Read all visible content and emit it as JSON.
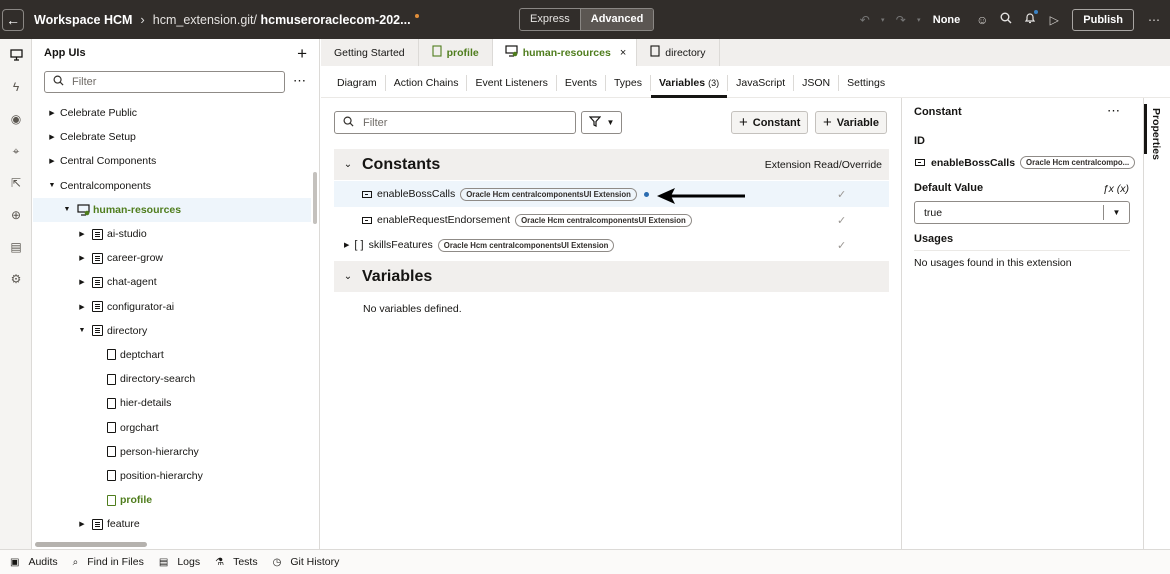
{
  "topbar": {
    "back_icon": "arrow-left-icon",
    "workspace_title": "Workspace HCM",
    "path_repo": "hcm_extension.git/",
    "path_branch": "hcmuseroraclecom-202...",
    "mode_express": "Express",
    "mode_advanced": "Advanced",
    "none_label": "None",
    "publish_label": "Publish"
  },
  "left_rail": {
    "icons": [
      "monitor-icon",
      "lightning-icon",
      "eye-icon",
      "pin-icon",
      "export-icon",
      "globe-icon",
      "file-icon",
      "settings-badge-icon"
    ]
  },
  "app_uis": {
    "title": "App UIs",
    "filter_placeholder": "Filter",
    "tree": [
      {
        "label": "Celebrate Public",
        "level": 0,
        "toggle": "collapsed",
        "icon": "none"
      },
      {
        "label": "Celebrate Setup",
        "level": 0,
        "toggle": "collapsed",
        "icon": "none"
      },
      {
        "label": "Central Components",
        "level": 0,
        "toggle": "collapsed",
        "icon": "none"
      },
      {
        "label": "Centralcomponents",
        "level": 0,
        "toggle": "expanded",
        "icon": "none"
      },
      {
        "label": "human-resources",
        "level": 1,
        "toggle": "expanded",
        "icon": "app-icon",
        "selected": true
      },
      {
        "label": "ai-studio",
        "level": 2,
        "toggle": "collapsed",
        "icon": "folder-icon"
      },
      {
        "label": "career-grow",
        "level": 2,
        "toggle": "collapsed",
        "icon": "folder-icon"
      },
      {
        "label": "chat-agent",
        "level": 2,
        "toggle": "collapsed",
        "icon": "folder-icon"
      },
      {
        "label": "configurator-ai",
        "level": 2,
        "toggle": "collapsed",
        "icon": "folder-icon"
      },
      {
        "label": "directory",
        "level": 2,
        "toggle": "expanded",
        "icon": "folder-icon"
      },
      {
        "label": "deptchart",
        "level": 3,
        "toggle": "none",
        "icon": "page-icon"
      },
      {
        "label": "directory-search",
        "level": 3,
        "toggle": "none",
        "icon": "page-icon"
      },
      {
        "label": "hier-details",
        "level": 3,
        "toggle": "none",
        "icon": "page-icon"
      },
      {
        "label": "orgchart",
        "level": 3,
        "toggle": "none",
        "icon": "page-icon"
      },
      {
        "label": "person-hierarchy",
        "level": 3,
        "toggle": "none",
        "icon": "page-icon"
      },
      {
        "label": "position-hierarchy",
        "level": 3,
        "toggle": "none",
        "icon": "page-icon"
      },
      {
        "label": "profile",
        "level": 3,
        "toggle": "none",
        "icon": "page-icon",
        "green": true
      },
      {
        "label": "feature",
        "level": 2,
        "toggle": "collapsed",
        "icon": "folder-icon"
      }
    ]
  },
  "tabs": [
    {
      "label": "Getting Started",
      "icon": ""
    },
    {
      "label": "profile",
      "icon": "page-icon",
      "green": true
    },
    {
      "label": "human-resources",
      "icon": "app-icon",
      "green": true,
      "active": true,
      "closable": true
    },
    {
      "label": "directory",
      "icon": "folder-icon"
    }
  ],
  "subtabs": [
    {
      "label": "Diagram"
    },
    {
      "label": "Action Chains"
    },
    {
      "label": "Event Listeners"
    },
    {
      "label": "Events"
    },
    {
      "label": "Types"
    },
    {
      "label": "Variables",
      "count": "(3)",
      "active": true
    },
    {
      "label": "JavaScript"
    },
    {
      "label": "JSON"
    },
    {
      "label": "Settings"
    }
  ],
  "variables_panel": {
    "filter_placeholder": "Filter",
    "add_constant": "Constant",
    "add_variable": "Variable",
    "constants_title": "Constants",
    "constants_right_label": "Extension Read/Override",
    "constants": [
      {
        "name": "enableBossCalls",
        "badge": "Oracle Hcm centralcomponentsUI Extension",
        "selected": true,
        "modified": true
      },
      {
        "name": "enableRequestEndorsement",
        "badge": "Oracle Hcm centralcomponentsUI Extension"
      },
      {
        "name": "skillsFeatures",
        "badge": "Oracle Hcm centralcomponentsUI Extension",
        "expandable": true
      }
    ],
    "variables_title": "Variables",
    "no_variables": "No variables defined."
  },
  "properties": {
    "title": "Constant",
    "id_label": "ID",
    "id_value": "enableBossCalls",
    "id_badge": "Oracle Hcm centralcompo...",
    "default_label": "Default Value",
    "fx_label": "ƒx  (x)",
    "default_value": "true",
    "usages_label": "Usages",
    "usages_text": "No usages found in this extension",
    "side_tab": "Properties"
  },
  "bottom_bar": [
    {
      "label": "Audits",
      "icon": "audit-icon"
    },
    {
      "label": "Find in Files",
      "icon": "search-icon"
    },
    {
      "label": "Logs",
      "icon": "logs-icon"
    },
    {
      "label": "Tests",
      "icon": "flask-icon"
    },
    {
      "label": "Git History",
      "icon": "clock-icon"
    }
  ]
}
